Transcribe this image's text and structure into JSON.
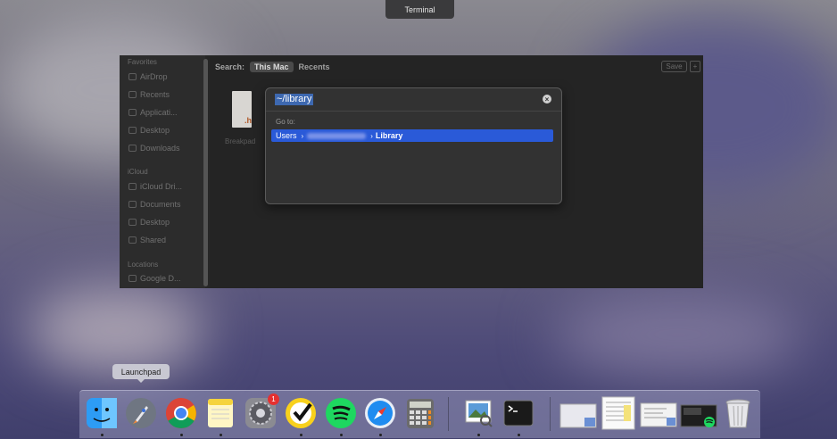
{
  "menubar": {
    "tooltip": "Terminal"
  },
  "finder": {
    "sidebar": {
      "favorites_header": "Favorites",
      "favorites": [
        "AirDrop",
        "Recents",
        "Applicati...",
        "Desktop",
        "Downloads"
      ],
      "icloud_header": "iCloud",
      "icloud": [
        "iCloud Dri...",
        "Documents",
        "Desktop",
        "Shared"
      ],
      "locations_header": "Locations",
      "locations": [
        "Google D..."
      ]
    },
    "search": {
      "label": "Search:",
      "scope_selected": "This Mac",
      "scope_other": "Recents",
      "save_label": "Save",
      "plus_label": "+"
    },
    "file": {
      "label": "Breakpad",
      "ext": ".h"
    }
  },
  "goto_dialog": {
    "input_value": "~/library",
    "goto_label": "Go to:",
    "suggestion": {
      "seg1": "Users",
      "sep": "›",
      "seg3": "Library"
    }
  },
  "dock": {
    "tooltip": "Launchpad",
    "settings_badge": "1",
    "items": [
      "finder-icon",
      "launchpad-icon",
      "chrome-icon",
      "notes-icon",
      "system-settings-icon",
      "norton-icon",
      "spotify-icon",
      "safari-icon",
      "calculator-icon",
      "preview-icon",
      "terminal-icon",
      "window-thumb-1",
      "window-thumb-2",
      "window-thumb-3",
      "window-thumb-4",
      "trash-icon"
    ]
  }
}
